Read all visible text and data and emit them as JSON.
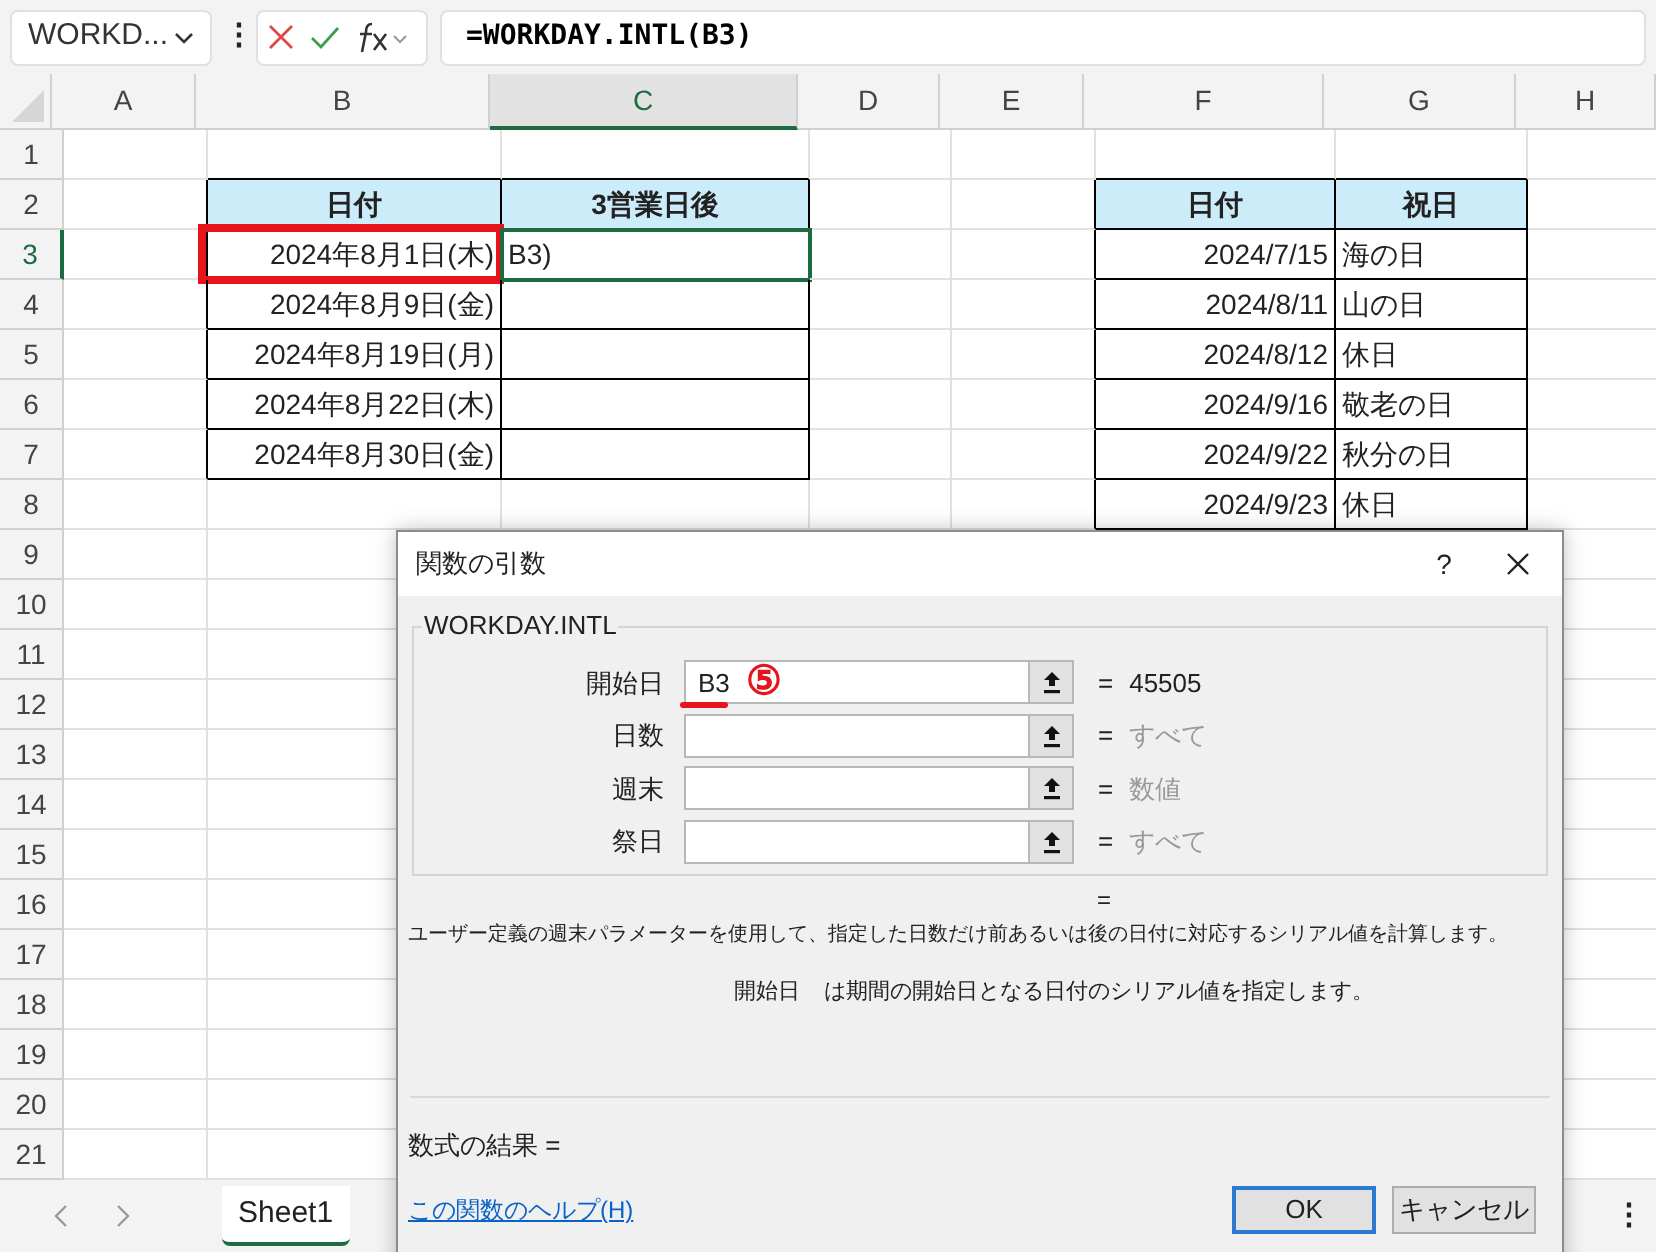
{
  "formula_bar": {
    "name_box": "WORKD...",
    "more": "⋮",
    "formula": "=WORKDAY.INTL(B3)"
  },
  "columns": [
    {
      "label": "A",
      "selected": false
    },
    {
      "label": "B",
      "selected": false
    },
    {
      "label": "C",
      "selected": true
    },
    {
      "label": "D",
      "selected": false
    },
    {
      "label": "E",
      "selected": false
    },
    {
      "label": "F",
      "selected": false
    },
    {
      "label": "G",
      "selected": false
    },
    {
      "label": "H",
      "selected": false
    }
  ],
  "rows": [
    {
      "label": "1",
      "selected": false
    },
    {
      "label": "2",
      "selected": false
    },
    {
      "label": "3",
      "selected": true
    },
    {
      "label": "4",
      "selected": false
    },
    {
      "label": "5",
      "selected": false
    },
    {
      "label": "6",
      "selected": false
    },
    {
      "label": "7",
      "selected": false
    },
    {
      "label": "8",
      "selected": false
    },
    {
      "label": "9",
      "selected": false
    },
    {
      "label": "10",
      "selected": false
    },
    {
      "label": "11",
      "selected": false
    },
    {
      "label": "12",
      "selected": false
    },
    {
      "label": "13",
      "selected": false
    },
    {
      "label": "14",
      "selected": false
    },
    {
      "label": "15",
      "selected": false
    },
    {
      "label": "16",
      "selected": false
    },
    {
      "label": "17",
      "selected": false
    },
    {
      "label": "18",
      "selected": false
    },
    {
      "label": "19",
      "selected": false
    },
    {
      "label": "20",
      "selected": false
    },
    {
      "label": "21",
      "selected": false
    }
  ],
  "date_table": {
    "header": [
      "日付",
      "3営業日後"
    ],
    "rows": [
      {
        "cells": [
          "2024年8月1日(木)",
          "B3)"
        ],
        "highlighted": true,
        "active": true
      },
      {
        "cells": [
          "2024年8月9日(金)",
          null
        ],
        "highlighted": false,
        "active": false
      },
      {
        "cells": [
          "2024年8月19日(月)",
          null
        ],
        "highlighted": false,
        "active": false
      },
      {
        "cells": [
          "2024年8月22日(木)",
          null
        ],
        "highlighted": false,
        "active": false
      },
      {
        "cells": [
          "2024年8月30日(金)",
          null
        ],
        "highlighted": false,
        "active": false
      }
    ]
  },
  "holiday_table": {
    "header": [
      "日付",
      "祝日"
    ],
    "rows": [
      [
        "2024/7/15",
        "海の日"
      ],
      [
        "2024/8/11",
        "山の日"
      ],
      [
        "2024/8/12",
        "休日"
      ],
      [
        "2024/9/16",
        "敬老の日"
      ],
      [
        "2024/9/22",
        "秋分の日"
      ],
      [
        "2024/9/23",
        "休日"
      ]
    ]
  },
  "sheet_tabs": [
    {
      "label": "Sheet1",
      "selected": true
    }
  ],
  "sheet_bar_more": "⋮",
  "dialog": {
    "title": "関数の引数",
    "help": "?",
    "function_name": "WORKDAY.INTL",
    "arguments": [
      {
        "label": "開始日",
        "value": "B3",
        "equals": "=",
        "result": "45505",
        "kind": "value",
        "annotation": "⑤"
      },
      {
        "label": "日数",
        "equals": "=",
        "result": "すべて",
        "kind": "hint"
      },
      {
        "label": "週末",
        "equals": "=",
        "result": "数値",
        "kind": "hint"
      },
      {
        "label": "祭日",
        "equals": "=",
        "result": "すべて",
        "kind": "hint"
      }
    ],
    "overall_equals": "=",
    "description": "ユーザー定義の週末パラメーターを使用して、指定した日数だけ前あるいは後の日付に対応するシリアル値を計算します。",
    "argument_name": "開始日",
    "argument_help": "は期間の開始日となる日付のシリアル値を指定します。",
    "result_label": "数式の結果 =",
    "help_link": "この関数のヘルプ(H)",
    "buttons": [
      "OK",
      "キャンセル"
    ]
  }
}
